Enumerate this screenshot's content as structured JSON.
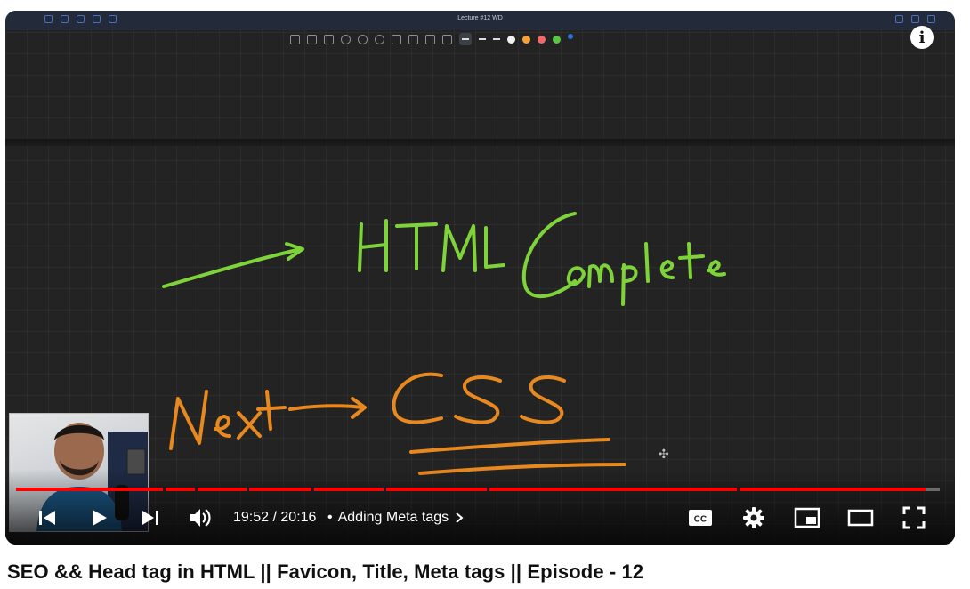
{
  "app": {
    "window_title": "Lecture #12 WD"
  },
  "overlay": {
    "info_label": "i"
  },
  "whiteboard": {
    "line1": "HTML Complete",
    "line2": "Next → CSS",
    "ink_colors": {
      "green": "#7fd33a",
      "orange": "#e8891f"
    }
  },
  "toolbar": {
    "colors": [
      "#f2f2f2",
      "#f5a13a",
      "#f06a6a",
      "#59c447",
      "#2b6fe0"
    ]
  },
  "player": {
    "current_time": "19:52",
    "duration": "20:16",
    "time_separator": "/",
    "chapter_label": "Adding Meta tags",
    "progress_fraction": 0.985,
    "accent_color": "#ff0000",
    "icons": [
      "previous-icon",
      "play-icon",
      "next-icon",
      "volume-icon",
      "captions-icon",
      "settings-icon",
      "miniplayer-icon",
      "theater-icon",
      "fullscreen-icon"
    ]
  },
  "video": {
    "title": "SEO && Head tag in HTML || Favicon, Title, Meta tags || Episode - 12"
  }
}
